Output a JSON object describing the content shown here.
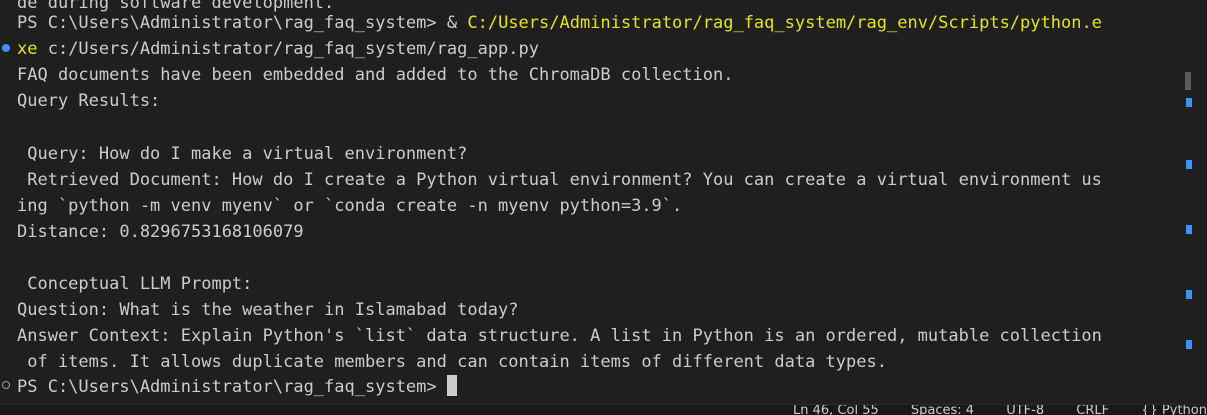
{
  "terminal": {
    "partial_top": "de during software development.",
    "prompt1": "PS C:\\Users\\Administrator\\rag_faq_system> ",
    "amp": "& ",
    "python_path_1": "C:/Users/Administrator/rag_faq_system/rag_env/Scripts/python.e",
    "python_path_2": "xe",
    "script_arg": " c:/Users/Administrator/rag_faq_system/rag_app.py",
    "line_embedded": "FAQ documents have been embedded and added to the ChromaDB collection.",
    "line_query_results": "Query Results:",
    "line_query": " Query: How do I make a virtual environment?",
    "line_retrieved_1": " Retrieved Document: How do I create a Python virtual environment? You can create a virtual environment us",
    "line_retrieved_2": "ing `python -m venv myenv` or `conda create -n myenv python=3.9`.",
    "line_distance": "Distance: 0.8296753168106079",
    "line_prompt_header": " Conceptual LLM Prompt:",
    "line_question": "Question: What is the weather in Islamabad today?",
    "line_answer_1": "Answer Context: Explain Python's `list` data structure. A list in Python is an ordered, mutable collection",
    "line_answer_2": " of items. It allows duplicate members and can contain items of different data types.",
    "prompt_final": "PS C:\\Users\\Administrator\\rag_faq_system> "
  },
  "colors": {
    "background": "#1f1f1f",
    "text": "#cccccc",
    "path_highlight": "#e5e510",
    "accent": "#3794ff"
  },
  "statusbar": {
    "position": "Ln 46, Col 55",
    "spaces": "Spaces: 4",
    "encoding": "UTF-8",
    "eol": "CRLF",
    "language": "{} Python"
  }
}
